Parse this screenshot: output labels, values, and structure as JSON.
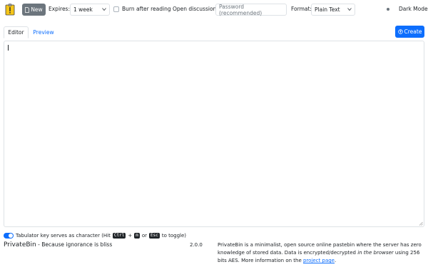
{
  "navbar": {
    "new_label": "New",
    "expires_label": "Expires:",
    "expires_value": "1 week",
    "burn_label": "Burn after reading",
    "open_discussion_label": "Open discussion",
    "password_placeholder": "Password (recommended)",
    "format_label": "Format:",
    "format_value": "Plain Text",
    "darkmode_label": "Dark Mode"
  },
  "tabs": [
    {
      "label": "Editor"
    },
    {
      "label": "Preview"
    }
  ],
  "create_label": "Create",
  "editor": {
    "value": ""
  },
  "footer": {
    "toggle_text_1": "Tabulator key serves as character (Hit",
    "kbd_ctrl": "Ctrl",
    "plus": "+",
    "kbd_m": "m",
    "or_text": "or",
    "kbd_esc": "Esc",
    "toggle_text_2": "to toggle)",
    "brand_name": "PrivateBin",
    "brand_tagline": " - Because ignorance is bliss",
    "version": "2.0.0",
    "about_1": "PrivateBin is a minimalist, open source online pastebin where the server has zero knowledge of stored data. Data is encrypted/decrypted ",
    "about_italic": "in the browser",
    "about_2": " using 256 bits AES. More information on the ",
    "about_link": "project page",
    "about_end": "."
  },
  "colors": {
    "primary": "#0d6efd",
    "secondary": "#6c757d",
    "logo": "#f5c518"
  }
}
